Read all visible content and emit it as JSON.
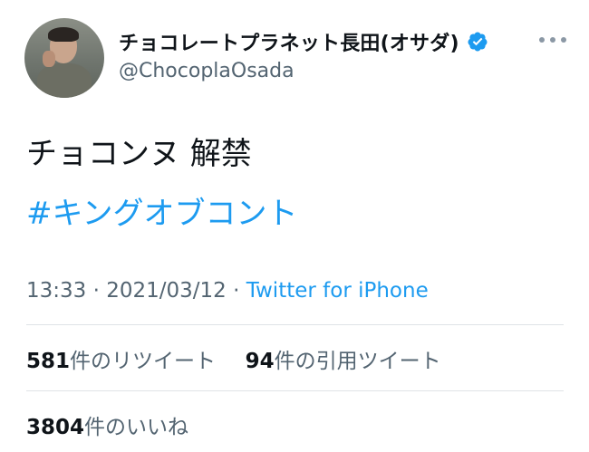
{
  "user": {
    "display_name": "チョコレートプラネット長田(オサダ)",
    "handle": "@ChocoplaOsada",
    "verified": true,
    "verified_color": "#1d9bf0"
  },
  "tweet": {
    "text": "チョコンヌ 解禁",
    "hashtag": "#キングオブコント",
    "time": "13:33",
    "separator": "·",
    "date": "2021/03/12",
    "source": "Twitter for iPhone"
  },
  "stats": {
    "retweets_count": "581",
    "retweets_label": "件のリツイート",
    "quotes_count": "94",
    "quotes_label": "件の引用ツイート",
    "likes_count": "3804",
    "likes_label": "件のいいね"
  },
  "colors": {
    "link": "#1d9bf0",
    "secondary_text": "#536471",
    "primary_text": "#0f1419"
  }
}
